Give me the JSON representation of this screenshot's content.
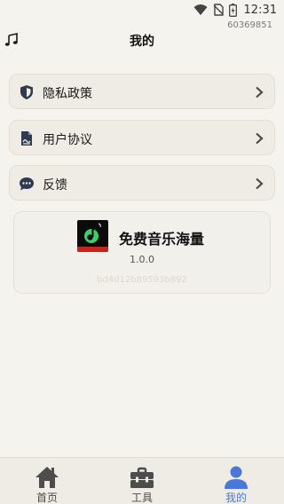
{
  "status_bar": {
    "time": "12:31",
    "icons": [
      "wifi-icon",
      "no-sim-icon",
      "battery-charging-icon"
    ]
  },
  "device_id": "60369851",
  "header": {
    "title": "我的",
    "icon": "music-note-icon"
  },
  "menu": [
    {
      "icon": "shield-icon",
      "label": "隐私政策"
    },
    {
      "icon": "document-icon",
      "label": "用户协议"
    },
    {
      "icon": "chat-bubble-icon",
      "label": "反馈"
    }
  ],
  "app_card": {
    "name": "免费音乐海量",
    "version": "1.0.0",
    "hash": "bd4d12b89593b892"
  },
  "tabbar": {
    "tabs": [
      {
        "label": "首页",
        "icon": "home-icon",
        "active": false
      },
      {
        "label": "工具",
        "icon": "toolbox-icon",
        "active": false
      },
      {
        "label": "我的",
        "icon": "user-icon",
        "active": true
      }
    ]
  },
  "colors": {
    "background": "#f5f3ee",
    "accent": "#4a78d8",
    "icon_dark": "#2f3a4f"
  }
}
